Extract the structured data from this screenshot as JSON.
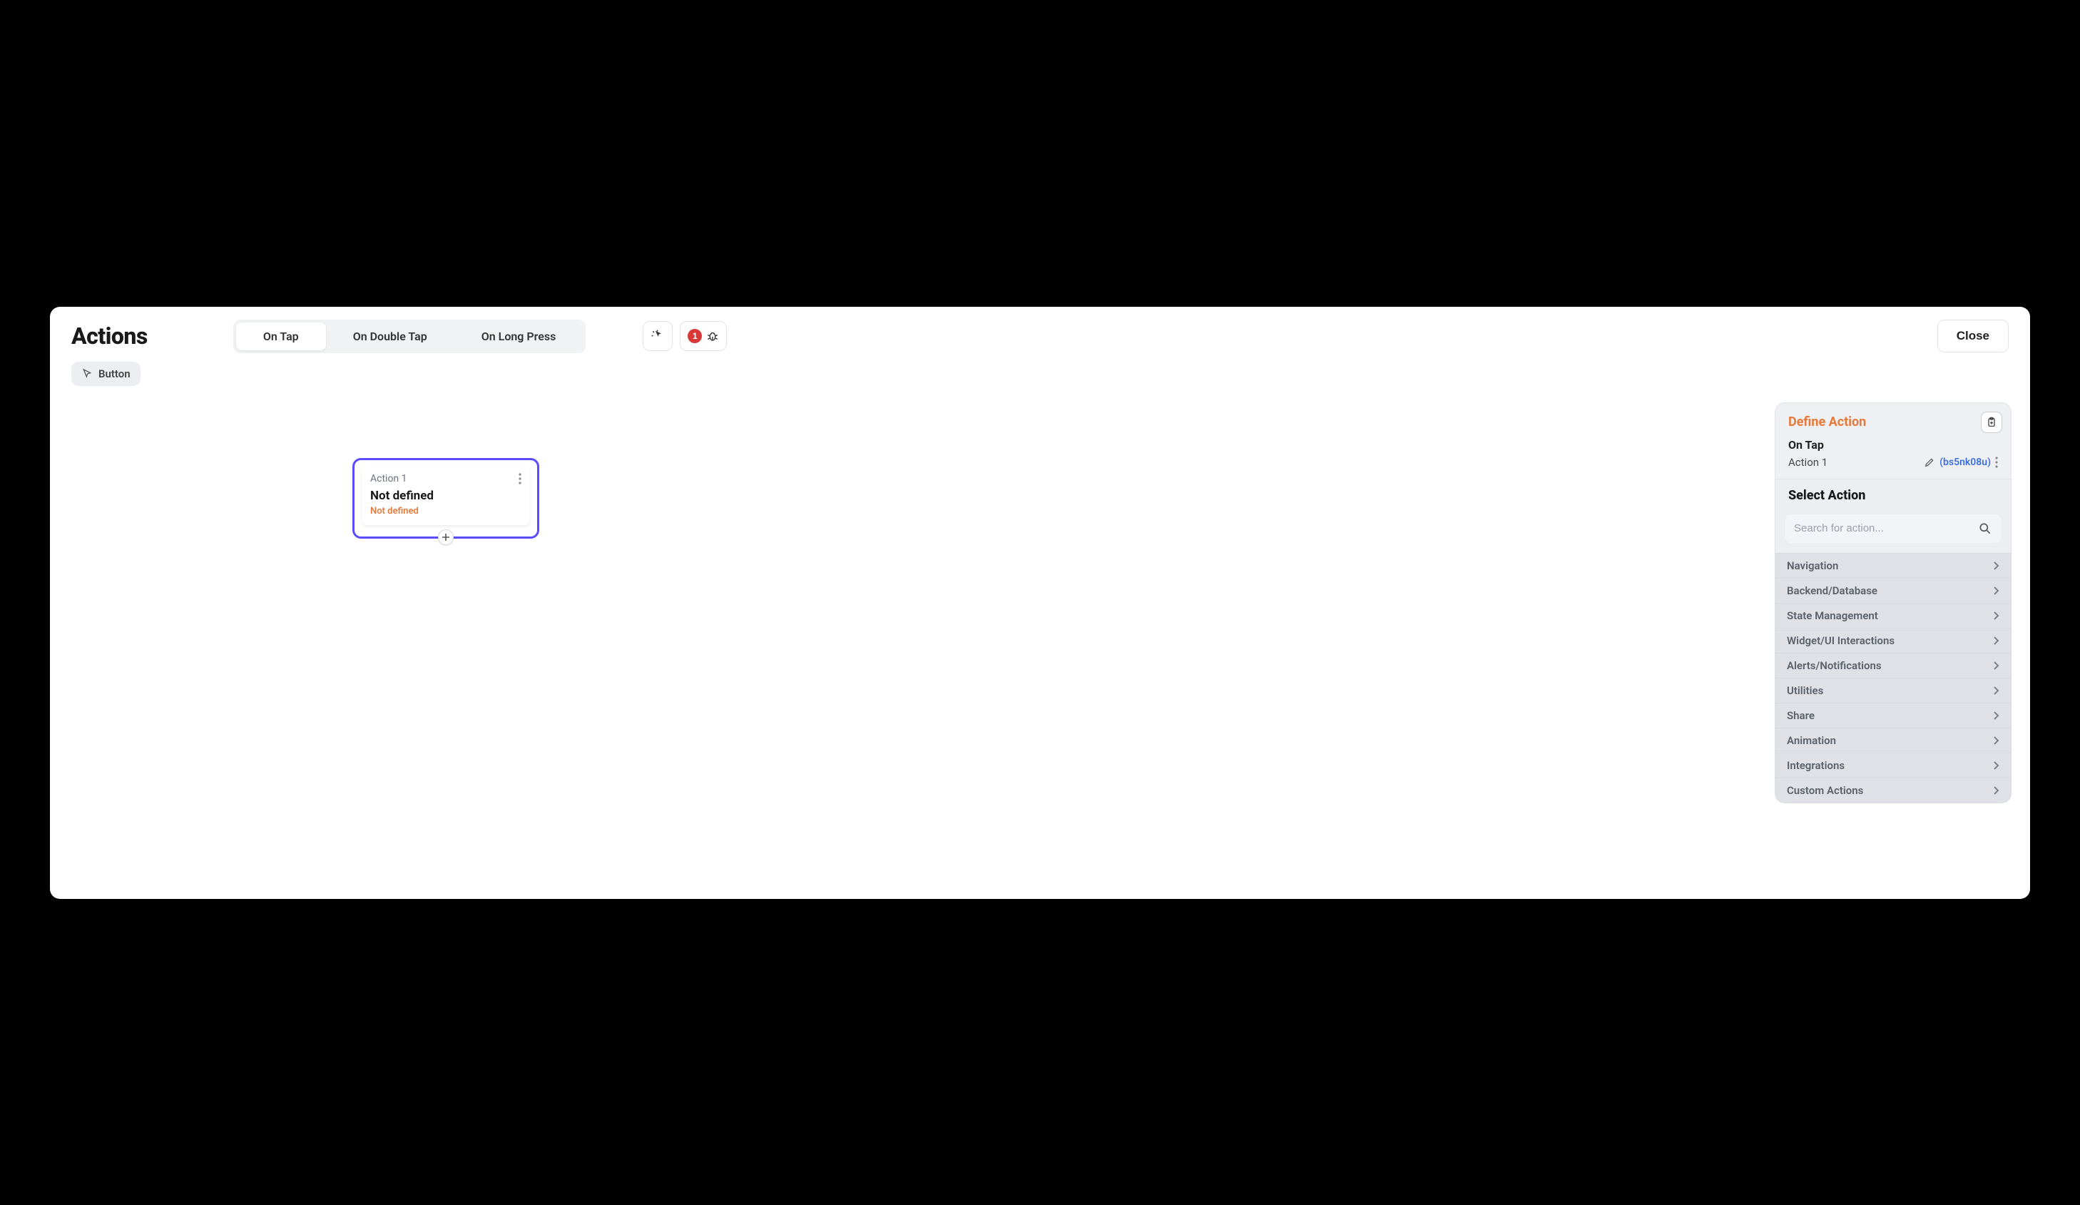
{
  "header": {
    "title": "Actions",
    "tabs": [
      "On Tap",
      "On Double Tap",
      "On Long Press"
    ],
    "active_tab": 0,
    "badge_count": "1",
    "close_label": "Close"
  },
  "chip": {
    "label": "Button"
  },
  "node": {
    "label": "Action 1",
    "title": "Not defined",
    "subtitle": "Not defined"
  },
  "panel": {
    "title": "Define Action",
    "event": "On Tap",
    "action_name": "Action 1",
    "action_id": "(bs5nk08u)",
    "select_title": "Select Action",
    "search_placeholder": "Search for action...",
    "categories": [
      "Navigation",
      "Backend/Database",
      "State Management",
      "Widget/UI Interactions",
      "Alerts/Notifications",
      "Utilities",
      "Share",
      "Animation",
      "Integrations",
      "Custom Actions"
    ]
  }
}
